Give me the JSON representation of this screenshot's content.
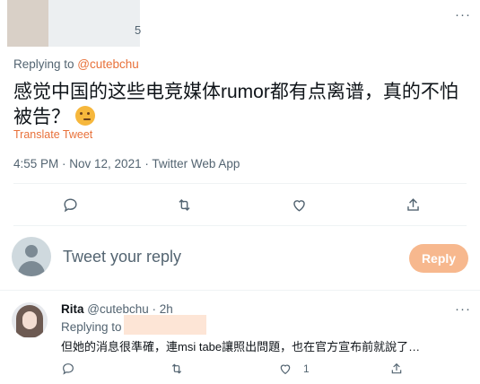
{
  "tweet": {
    "handle_tail": "5",
    "replying_prefix": "Replying to ",
    "replying_mention": "@cutebchu",
    "text": "感觉中国的这些电竞媒体rumor都有点离谱，真的不怕被告？",
    "emoji": "thinking-face",
    "translate": "Translate Tweet",
    "meta": "4:55 PM · Nov 12, 2021 · Twitter Web App",
    "actions": [
      "reply-icon",
      "retweet-icon",
      "like-icon",
      "share-icon"
    ]
  },
  "composer": {
    "placeholder": "Tweet your reply",
    "reply_label": "Reply"
  },
  "reply": {
    "name": "Rita",
    "handle": "@cutebchu · 2h",
    "replying_prefix": "Replying to",
    "text": "但她的消息很準確，連msi tabe讓照出問題，也在官方宣布前就說了…",
    "like_count": "1"
  },
  "colors": {
    "accent": "#e8713a",
    "reply_button": "#f7b88e",
    "muted": "#536471"
  }
}
